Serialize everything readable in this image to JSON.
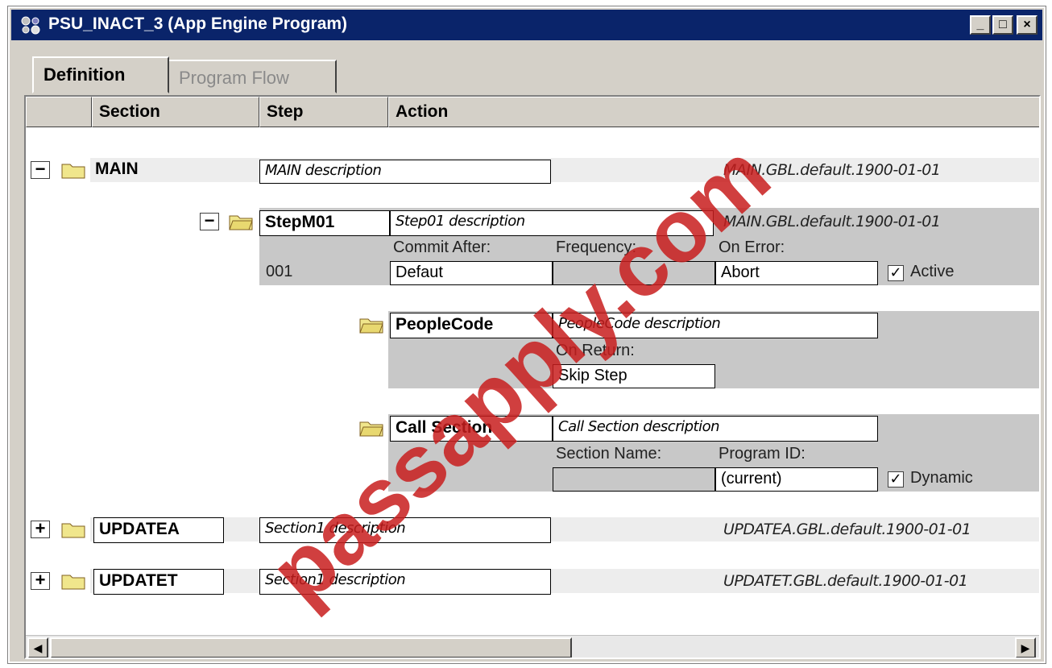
{
  "window": {
    "title": "PSU_INACT_3 (App Engine Program)",
    "minimize": "_",
    "maximize": "□",
    "close": "×"
  },
  "tabs": [
    {
      "label": "Definition",
      "active": true
    },
    {
      "label": "Program Flow",
      "active": false
    }
  ],
  "columns": {
    "section": "Section",
    "step": "Step",
    "action": "Action"
  },
  "sections": {
    "main": {
      "toggle": "−",
      "name": "MAIN",
      "description": "MAIN description",
      "market": "MAIN.GBL.default.1900-01-01",
      "step": {
        "toggle": "−",
        "name": "StepM01",
        "description": "Step01 description",
        "market": "MAIN.GBL.default.1900-01-01",
        "number": "001",
        "commit_after_label": "Commit After:",
        "commit_after_value": "Defaut",
        "frequency_label": "Frequency:",
        "frequency_value": "",
        "on_error_label": "On Error:",
        "on_error_value": "Abort",
        "active_label": "Active",
        "active_checked": true
      },
      "actions": [
        {
          "name": "PeopleCode",
          "description": "PeopleCode description",
          "on_return_label": "On Return:",
          "on_return_value": "Skip Step"
        },
        {
          "name": "Call Section",
          "description": "Call Section description",
          "section_name_label": "Section Name:",
          "section_name_value": "",
          "program_id_label": "Program ID:",
          "program_id_value": "(current)",
          "dynamic_label": "Dynamic",
          "dynamic_checked": true
        }
      ]
    },
    "updatea": {
      "toggle": "+",
      "name": "UPDATEA",
      "description": "Section1 description",
      "market": "UPDATEA.GBL.default.1900-01-01"
    },
    "updatet": {
      "toggle": "+",
      "name": "UPDATET",
      "description": "Section1 description",
      "market": "UPDATET.GBL.default.1900-01-01"
    }
  },
  "scrollbar": {
    "left": "◀",
    "right": "▶"
  },
  "watermark": "passapply.com",
  "colors": {
    "titlebar": "#0a246a",
    "watermark": "#c81e1e",
    "window": "#d4d0c8"
  }
}
